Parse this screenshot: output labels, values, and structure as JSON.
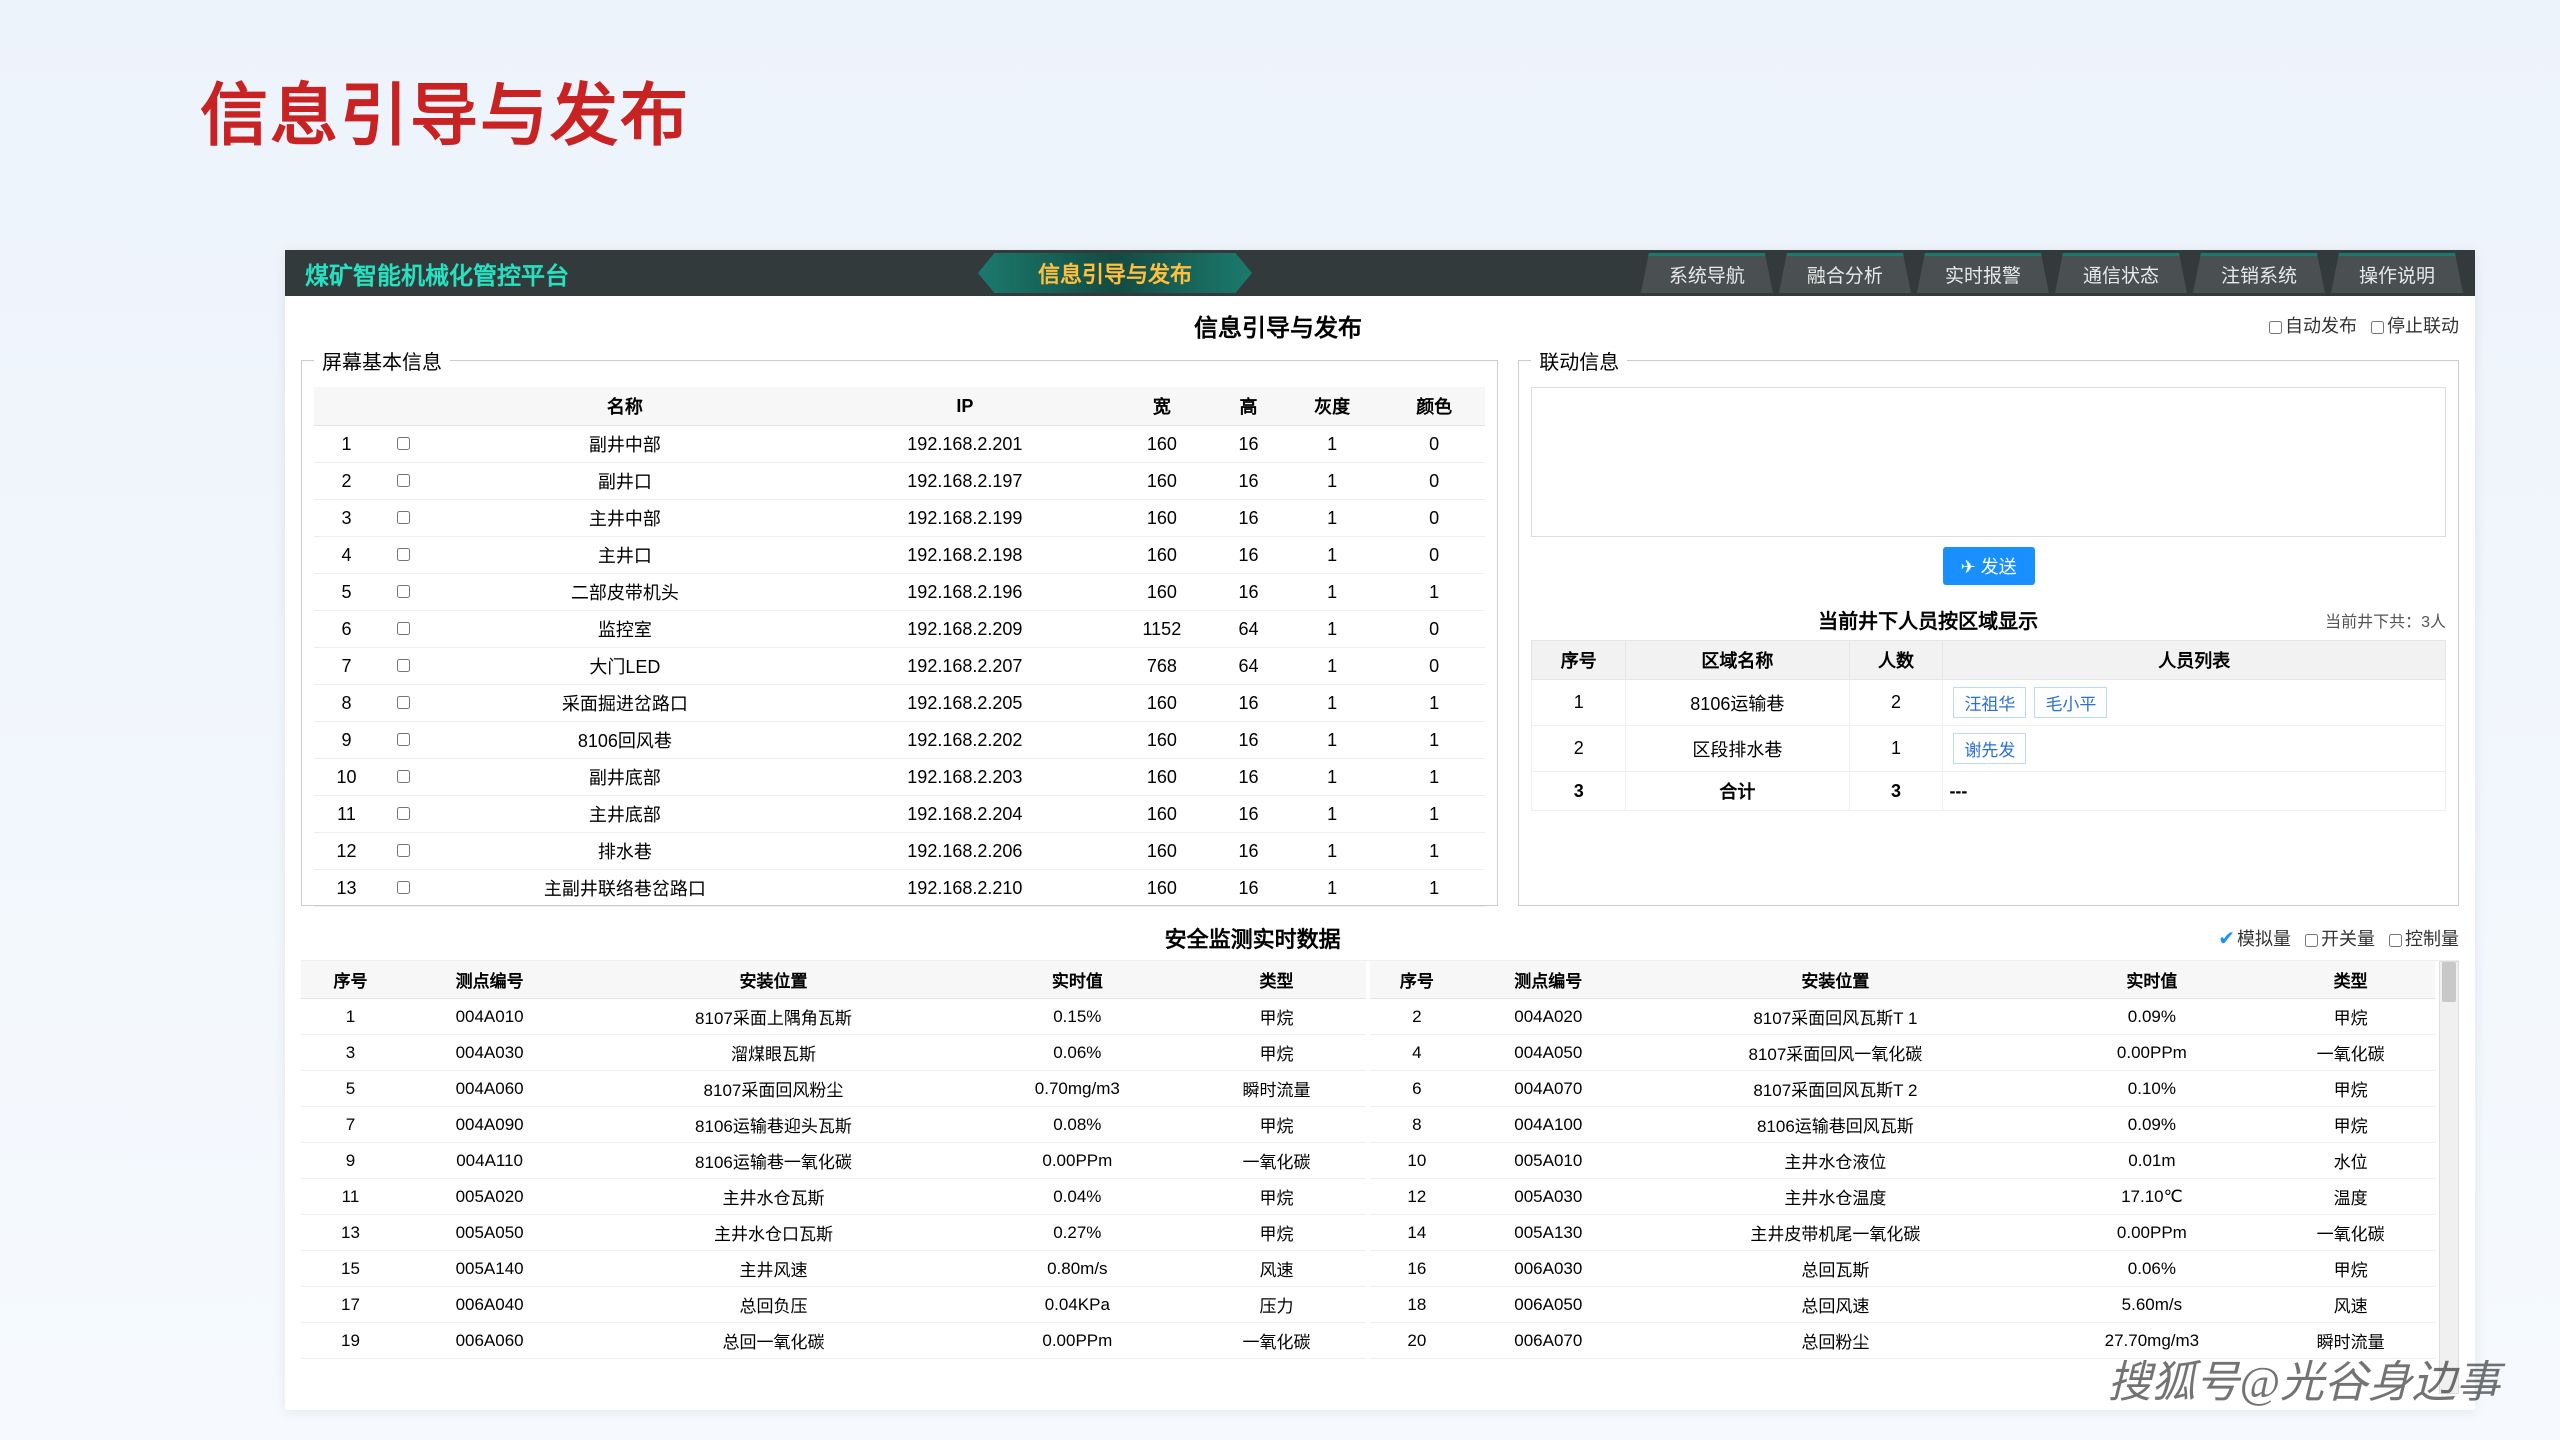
{
  "slide_title": "信息引导与发布",
  "logo": "煤矿智能机械化管控平台",
  "banner": "信息引导与发布",
  "nav": [
    "系统导航",
    "融合分析",
    "实时报警",
    "通信状态",
    "注销系统",
    "操作说明"
  ],
  "page_title": "信息引导与发布",
  "opts": {
    "auto": "自动发布",
    "stop": "停止联动"
  },
  "screen_panel": {
    "legend": "屏幕基本信息",
    "headers": [
      "",
      "",
      "名称",
      "IP",
      "宽",
      "高",
      "灰度",
      "颜色"
    ],
    "rows": [
      [
        "1",
        "副井中部",
        "192.168.2.201",
        "160",
        "16",
        "1",
        "0"
      ],
      [
        "2",
        "副井口",
        "192.168.2.197",
        "160",
        "16",
        "1",
        "0"
      ],
      [
        "3",
        "主井中部",
        "192.168.2.199",
        "160",
        "16",
        "1",
        "0"
      ],
      [
        "4",
        "主井口",
        "192.168.2.198",
        "160",
        "16",
        "1",
        "0"
      ],
      [
        "5",
        "二部皮带机头",
        "192.168.2.196",
        "160",
        "16",
        "1",
        "1"
      ],
      [
        "6",
        "监控室",
        "192.168.2.209",
        "1152",
        "64",
        "1",
        "0"
      ],
      [
        "7",
        "大门LED",
        "192.168.2.207",
        "768",
        "64",
        "1",
        "0"
      ],
      [
        "8",
        "采面掘进岔路口",
        "192.168.2.205",
        "160",
        "16",
        "1",
        "1"
      ],
      [
        "9",
        "8106回风巷",
        "192.168.2.202",
        "160",
        "16",
        "1",
        "1"
      ],
      [
        "10",
        "副井底部",
        "192.168.2.203",
        "160",
        "16",
        "1",
        "1"
      ],
      [
        "11",
        "主井底部",
        "192.168.2.204",
        "160",
        "16",
        "1",
        "1"
      ],
      [
        "12",
        "排水巷",
        "192.168.2.206",
        "160",
        "16",
        "1",
        "1"
      ],
      [
        "13",
        "主副井联络巷岔路口",
        "192.168.2.210",
        "160",
        "16",
        "1",
        "1"
      ]
    ]
  },
  "link_panel": {
    "legend": "联动信息",
    "send_icon": "✈",
    "send": "发送",
    "ppl_title": "当前井下人员按区域显示",
    "ppl_count": "当前井下共：3人",
    "ppl_headers": [
      "序号",
      "区域名称",
      "人数",
      "人员列表"
    ],
    "ppl_rows": [
      {
        "idx": "1",
        "area": "8106运输巷",
        "num": "2",
        "people": [
          "汪祖华",
          "毛小平"
        ]
      },
      {
        "idx": "2",
        "area": "区段排水巷",
        "num": "1",
        "people": [
          "谢先发"
        ]
      },
      {
        "idx": "3",
        "area": "合计",
        "num": "3",
        "people_text": "---",
        "bold": true
      }
    ]
  },
  "monitor": {
    "title": "安全监测实时数据",
    "opts": {
      "sim": "模拟量",
      "switch": "开关量",
      "ctrl": "控制量"
    },
    "headers": [
      "序号",
      "测点编号",
      "安装位置",
      "实时值",
      "类型"
    ],
    "left": [
      [
        "1",
        "004A010",
        "8107采面上隅角瓦斯",
        "0.15%",
        "甲烷"
      ],
      [
        "3",
        "004A030",
        "溜煤眼瓦斯",
        "0.06%",
        "甲烷"
      ],
      [
        "5",
        "004A060",
        "8107采面回风粉尘",
        "0.70mg/m3",
        "瞬时流量"
      ],
      [
        "7",
        "004A090",
        "8106运输巷迎头瓦斯",
        "0.08%",
        "甲烷"
      ],
      [
        "9",
        "004A110",
        "8106运输巷一氧化碳",
        "0.00PPm",
        "一氧化碳"
      ],
      [
        "11",
        "005A020",
        "主井水仓瓦斯",
        "0.04%",
        "甲烷"
      ],
      [
        "13",
        "005A050",
        "主井水仓口瓦斯",
        "0.27%",
        "甲烷"
      ],
      [
        "15",
        "005A140",
        "主井风速",
        "0.80m/s",
        "风速"
      ],
      [
        "17",
        "006A040",
        "总回负压",
        "0.04KPa",
        "压力"
      ],
      [
        "19",
        "006A060",
        "总回一氧化碳",
        "0.00PPm",
        "一氧化碳"
      ]
    ],
    "right": [
      [
        "2",
        "004A020",
        "8107采面回风瓦斯T 1",
        "0.09%",
        "甲烷"
      ],
      [
        "4",
        "004A050",
        "8107采面回风一氧化碳",
        "0.00PPm",
        "一氧化碳"
      ],
      [
        "6",
        "004A070",
        "8107采面回风瓦斯T 2",
        "0.10%",
        "甲烷"
      ],
      [
        "8",
        "004A100",
        "8106运输巷回风瓦斯",
        "0.09%",
        "甲烷"
      ],
      [
        "10",
        "005A010",
        "主井水仓液位",
        "0.01m",
        "水位"
      ],
      [
        "12",
        "005A030",
        "主井水仓温度",
        "17.10℃",
        "温度"
      ],
      [
        "14",
        "005A130",
        "主井皮带机尾一氧化碳",
        "0.00PPm",
        "一氧化碳"
      ],
      [
        "16",
        "006A030",
        "总回瓦斯",
        "0.06%",
        "甲烷"
      ],
      [
        "18",
        "006A050",
        "总回风速",
        "5.60m/s",
        "风速"
      ],
      [
        "20",
        "006A070",
        "总回粉尘",
        "27.70mg/m3",
        "瞬时流量"
      ]
    ]
  },
  "watermark": "搜狐号@光谷身边事"
}
